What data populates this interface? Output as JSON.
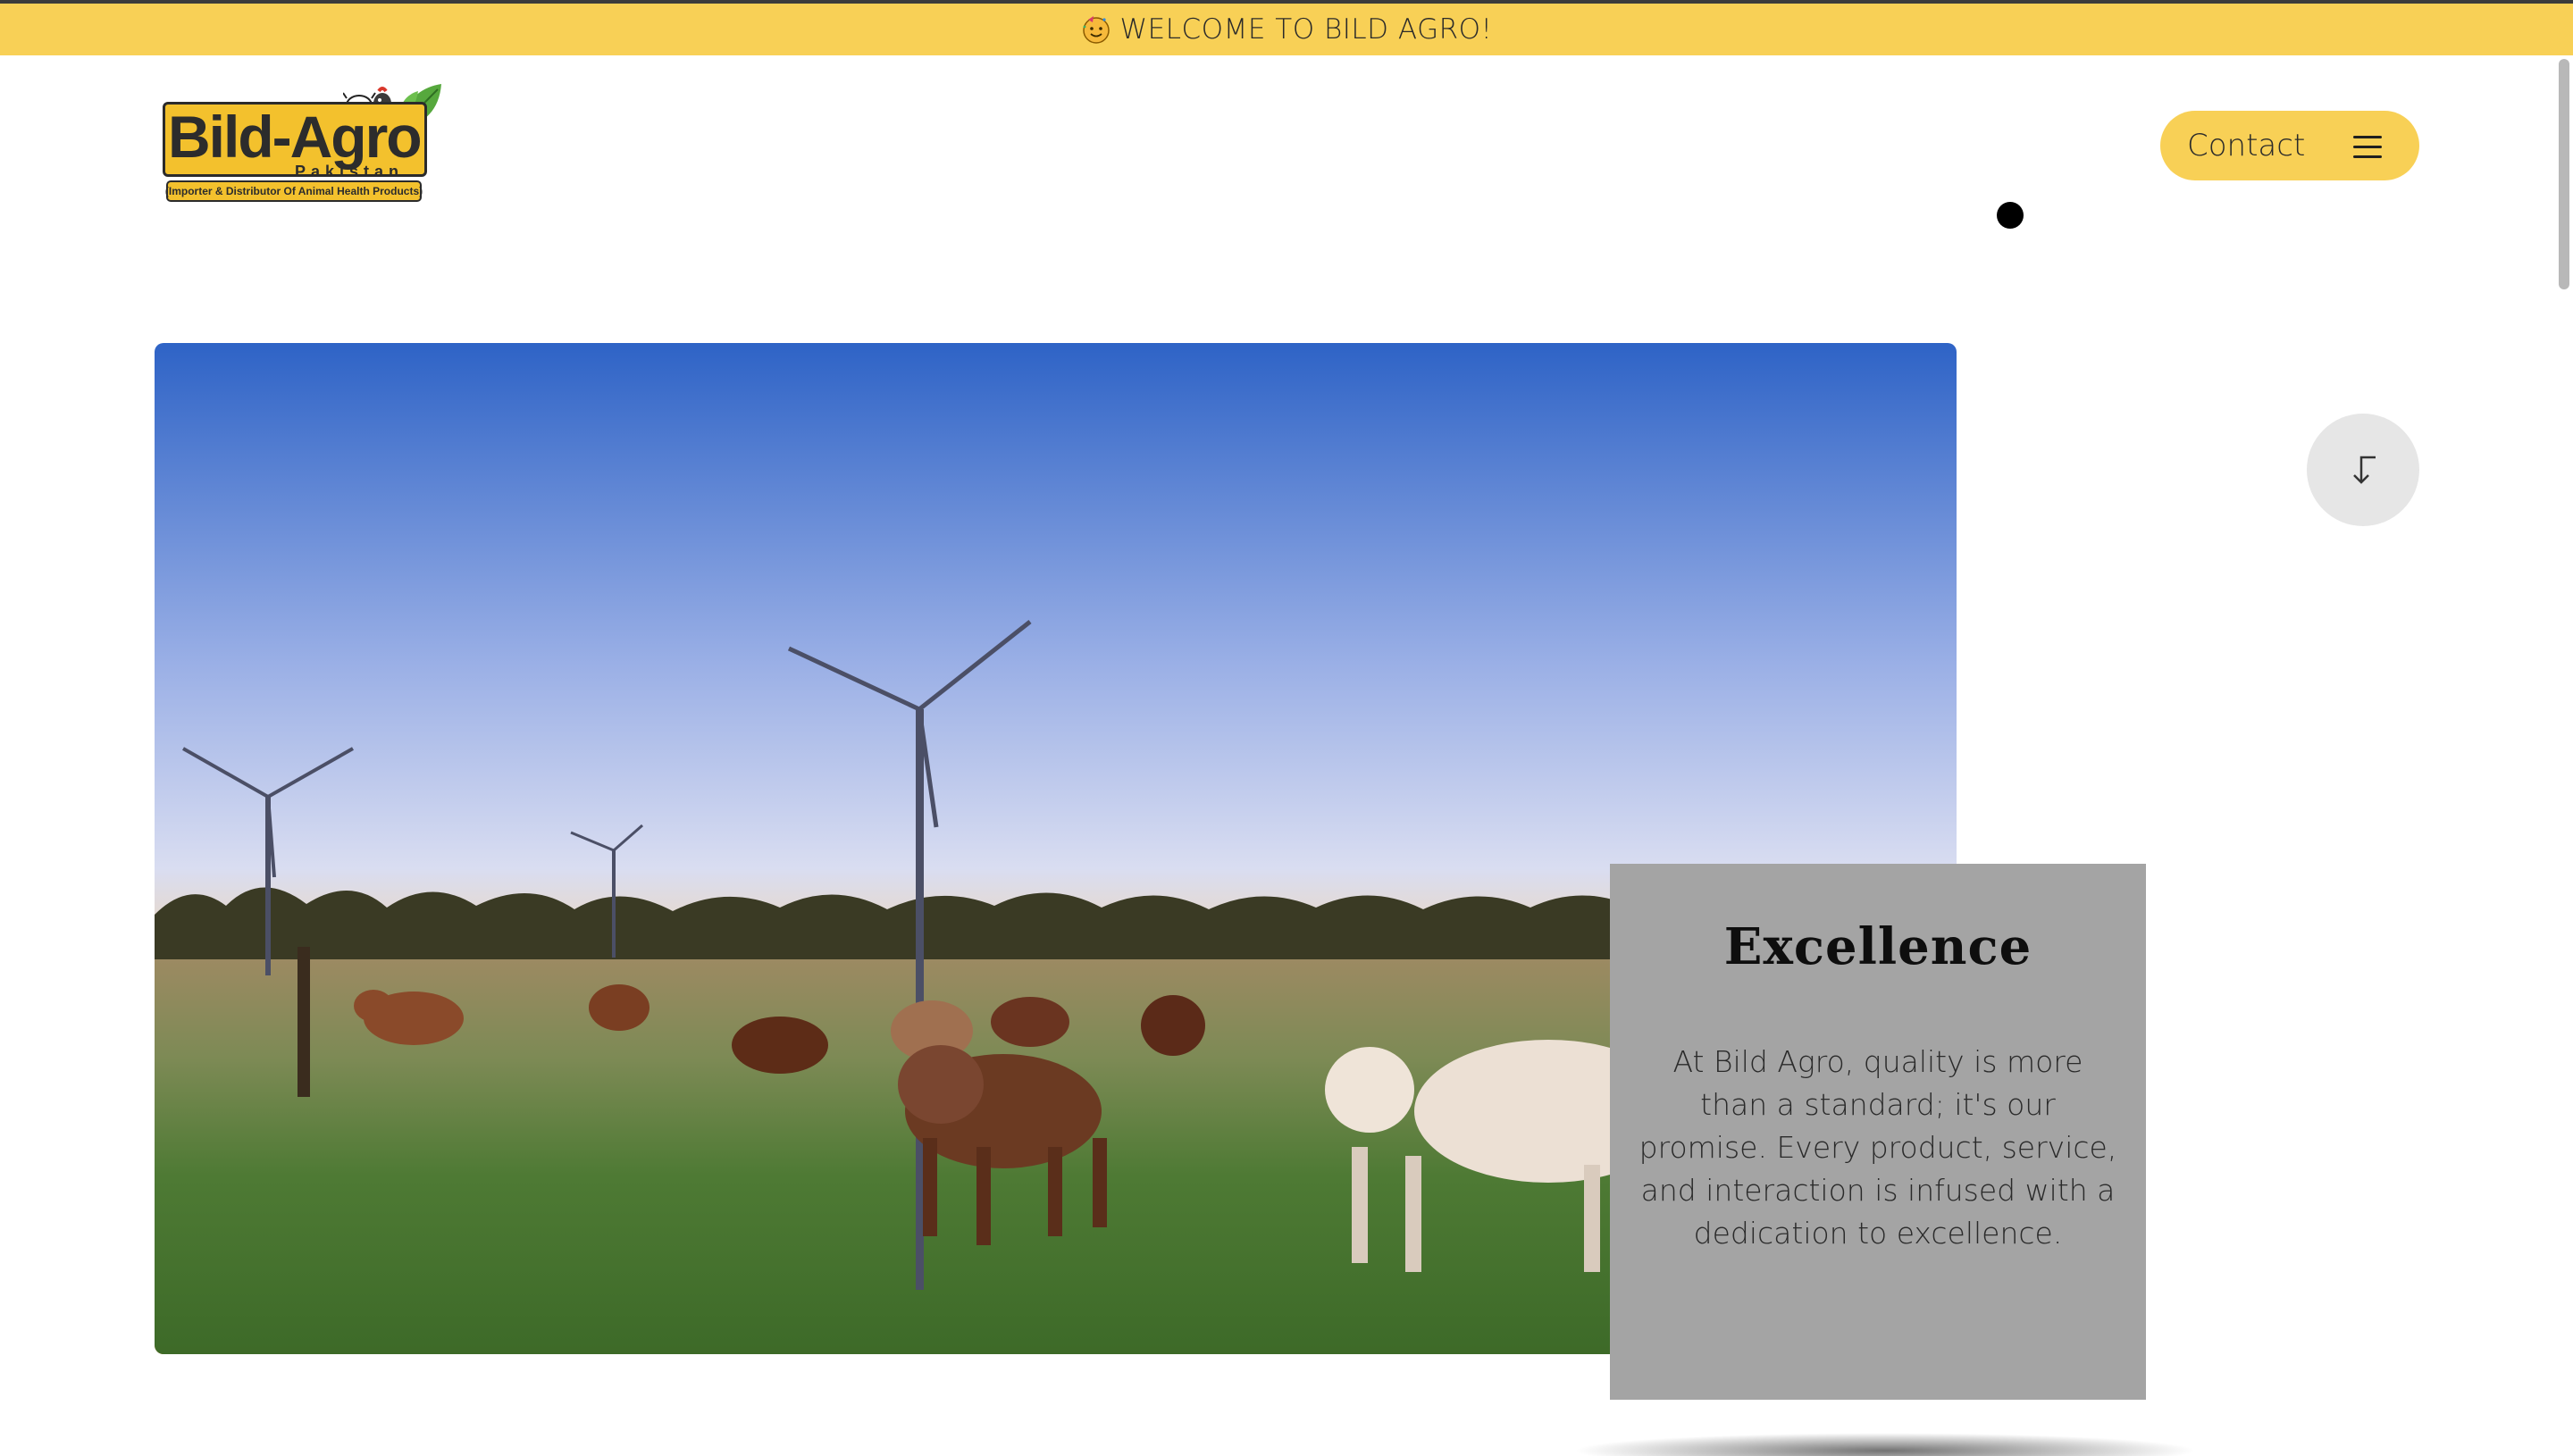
{
  "welcome_bar": {
    "emoji": "🥳",
    "text": "WELCOME TO BILD AGRO!"
  },
  "logo": {
    "word_bild": "Bild",
    "word_dash": "-",
    "word_agro": "Agro",
    "subtitle": "Pakistan",
    "tagline": "(Importer & Distributor Of Animal Health Products)"
  },
  "header": {
    "contact_label": "Contact",
    "menu_icon": "hamburger-menu-icon"
  },
  "hero": {
    "image_subject": "cattle-field-wind-turbines-sunset"
  },
  "scroll_button": {
    "icon": "arrow-down-left-icon"
  },
  "feature_card": {
    "title": "Excellence",
    "text": "At Bild Agro, quality is more than a standard; it's our promise. Every product, service, and interaction is infused with a dedication to excellence."
  },
  "colors": {
    "accent_yellow": "#f8d056",
    "card_gray": "#a4a4a4",
    "text_dark": "#2a2a2a"
  }
}
